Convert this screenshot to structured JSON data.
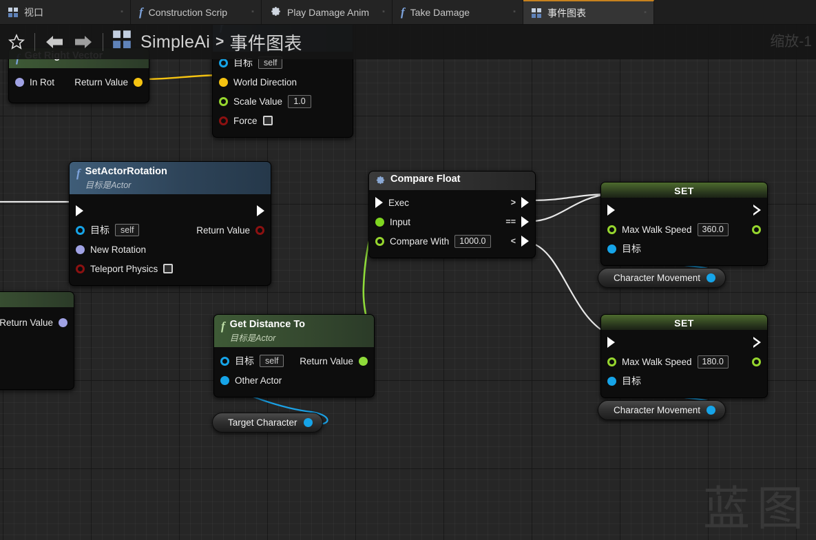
{
  "window": {
    "zoom_label": "缩放-1",
    "watermark": "蓝图"
  },
  "tabs": [
    {
      "label": "视口",
      "icon": "viewport-grid-icon",
      "active": false,
      "has_close": true
    },
    {
      "label": "Construction Scrip",
      "icon": "function-fx-icon",
      "active": false,
      "has_close": true
    },
    {
      "label": "Play Damage Anim",
      "icon": "gear-icon",
      "active": false,
      "has_close": true
    },
    {
      "label": "Take Damage",
      "icon": "function-fx-icon",
      "active": false,
      "has_close": true
    },
    {
      "label": "事件图表",
      "icon": "event-graph-grid-icon",
      "active": true,
      "has_close": true
    }
  ],
  "breadcrumb": {
    "star_icon": "favorite-star-icon",
    "back_icon": "back-arrow-icon",
    "forward_icon": "forward-arrow-icon",
    "blueprint_icon": "blueprint-grid-icon",
    "root": "SimpleAi",
    "separator": ">",
    "current": "事件图表"
  },
  "nodes": {
    "get_right_vector": {
      "title": "Get Right Vector",
      "inputs": [
        {
          "label": "In Rot",
          "pin": "struct-rotator"
        }
      ],
      "outputs": [
        {
          "label": "Return Value",
          "pin": "struct-vector"
        }
      ]
    },
    "add_movement_input": {
      "target_label": "目标",
      "target_value": "self",
      "rows": [
        {
          "label": "World Direction",
          "pin": "struct-vector",
          "value": null
        },
        {
          "label": "Scale Value",
          "pin": "float",
          "value": "1.0"
        },
        {
          "label": "Force",
          "pin": "bool",
          "value": "checkbox"
        }
      ]
    },
    "set_actor_rotation": {
      "title": "SetActorRotation",
      "subtitle": "目标是Actor",
      "inputs": [
        {
          "label": "目标",
          "pin": "object",
          "value": "self"
        },
        {
          "label": "New Rotation",
          "pin": "struct-rotator",
          "value": null
        },
        {
          "label": "Teleport Physics",
          "pin": "bool",
          "value": "checkbox"
        }
      ],
      "outputs": [
        {
          "label": "Return Value",
          "pin": "bool"
        }
      ]
    },
    "compare_float": {
      "title": "Compare Float",
      "icon": "gear-icon",
      "inputs": [
        {
          "label": "Exec",
          "pin": "exec"
        },
        {
          "label": "Input",
          "pin": "float-filled"
        },
        {
          "label": "Compare With",
          "pin": "float",
          "value": "1000.0"
        }
      ],
      "outputs": [
        {
          "op": ">",
          "pin": "exec"
        },
        {
          "op": "==",
          "pin": "exec"
        },
        {
          "op": "<",
          "pin": "exec"
        }
      ]
    },
    "get_distance_to": {
      "title": "Get Distance To",
      "subtitle": "目标是Actor",
      "inputs": [
        {
          "label": "目标",
          "pin": "object",
          "value": "self"
        },
        {
          "label": "Other Actor",
          "pin": "object-filled",
          "value": null
        }
      ],
      "outputs": [
        {
          "label": "Return Value",
          "pin": "float-filled"
        }
      ]
    },
    "set_speed_1": {
      "title": "SET",
      "rows": [
        {
          "label": "Max Walk Speed",
          "pin": "float",
          "value": "360.0"
        },
        {
          "label": "目标",
          "pin": "object-filled",
          "value": null
        }
      ]
    },
    "set_speed_2": {
      "title": "SET",
      "rows": [
        {
          "label": "Max Walk Speed",
          "pin": "float",
          "value": "180.0"
        },
        {
          "label": "目标",
          "pin": "object-filled",
          "value": null
        }
      ]
    },
    "character_movement_1": {
      "label": "Character Movement",
      "pin": "object-filled"
    },
    "character_movement_2": {
      "label": "Character Movement",
      "pin": "object-filled"
    },
    "target_character": {
      "label": "Target Character",
      "pin": "object-filled"
    },
    "clipped_return_left": {
      "label": "Return Value",
      "pin": "struct-rotator"
    }
  },
  "colors": {
    "exec_wire": "#e8e8e8",
    "float_wire": "#8fdb3a",
    "object_wire": "#1ba3e8",
    "vector_wire": "#f5c311",
    "accent_tab": "#c8821e",
    "pin_float": "#96d62e",
    "pin_object": "#16a4e8",
    "pin_vector": "#f5c411",
    "pin_bool": "#8c1111",
    "pin_rotator": "#a0a2e4",
    "canvas_bg": "#262626"
  }
}
